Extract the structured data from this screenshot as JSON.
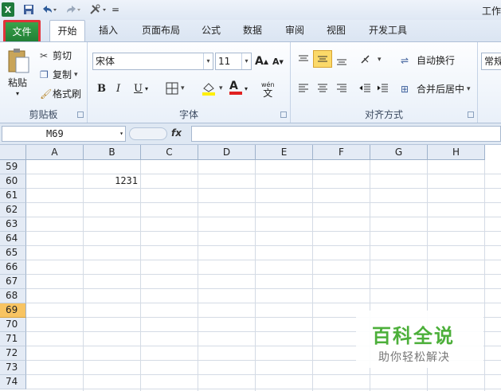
{
  "window": {
    "title": "工作"
  },
  "qat": {
    "customize_glyph": "="
  },
  "tabs": [
    {
      "label": "文件"
    },
    {
      "label": "开始"
    },
    {
      "label": "插入"
    },
    {
      "label": "页面布局"
    },
    {
      "label": "公式"
    },
    {
      "label": "数据"
    },
    {
      "label": "审阅"
    },
    {
      "label": "视图"
    },
    {
      "label": "开发工具"
    }
  ],
  "clipboard": {
    "paste": "粘贴",
    "cut": "剪切",
    "copy": "复制",
    "format_painter": "格式刷",
    "group": "剪贴板"
  },
  "font": {
    "name": "宋体",
    "size": "11",
    "bold": "B",
    "italic": "I",
    "underline": "U",
    "font_color": "A",
    "phonetic": "wén",
    "group": "字体"
  },
  "alignment": {
    "wrap": "自动换行",
    "merge": "合并后居中",
    "group": "对齐方式"
  },
  "number": {
    "format": "常规"
  },
  "formula_bar": {
    "name_box": "M69",
    "fx": "fx",
    "value": ""
  },
  "sheet": {
    "columns": [
      "A",
      "B",
      "C",
      "D",
      "E",
      "F",
      "G",
      "H"
    ],
    "rows": [
      "59",
      "60",
      "61",
      "62",
      "63",
      "64",
      "65",
      "66",
      "67",
      "68",
      "69",
      "70",
      "71",
      "72",
      "73",
      "74"
    ],
    "selected_row": "69",
    "cells": [
      {
        "row": "60",
        "col": "B",
        "value": "1231"
      }
    ]
  },
  "watermark": {
    "title": "百科全说",
    "subtitle": "助你轻松解决"
  },
  "colors": {
    "file_tab": "#1e7b33",
    "file_highlight": "#e2333a",
    "selected_row": "#f8c462",
    "watermark": "#4caf3a"
  }
}
